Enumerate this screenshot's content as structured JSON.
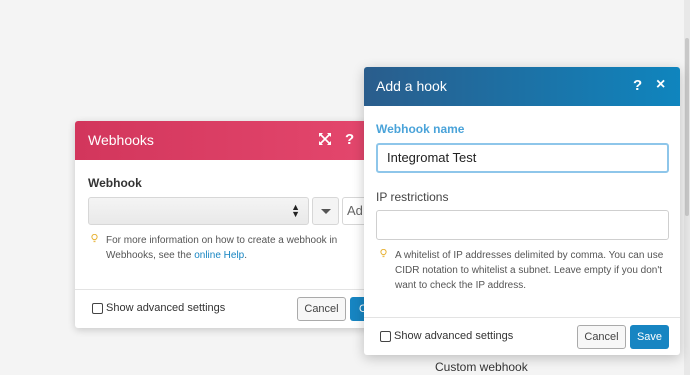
{
  "webhooks_dialog": {
    "title": "Webhooks",
    "expand_icon": "expand-arrows-icon",
    "help": "?",
    "field_label": "Webhook",
    "select_value": "",
    "add_button_partial": "Ad",
    "hint_text": "For more information on how to create a webhook in Webhooks, see the ",
    "hint_link": "online Help",
    "hint_end": ".",
    "advanced_label": "Show advanced settings",
    "cancel_label": "Cancel",
    "ok_label_partial": "O"
  },
  "add_hook_dialog": {
    "title": "Add a hook",
    "help": "?",
    "close": "×",
    "name_label": "Webhook name",
    "name_value": "Integromat Test",
    "ip_label": "IP restrictions",
    "ip_value": "",
    "hint_text": "A whitelist of IP addresses delimited by comma. You can use CIDR notation to whitelist a subnet. Leave empty if you don't want to check the IP address.",
    "advanced_label": "Show advanced settings",
    "cancel_label": "Cancel",
    "save_label": "Save"
  },
  "module_label": "Custom webhook",
  "colors": {
    "webhooks_header": "#d2365c",
    "add_hook_header": "#0f85be",
    "primary_button": "#1785c2",
    "label_accent": "#4aa3d9"
  }
}
